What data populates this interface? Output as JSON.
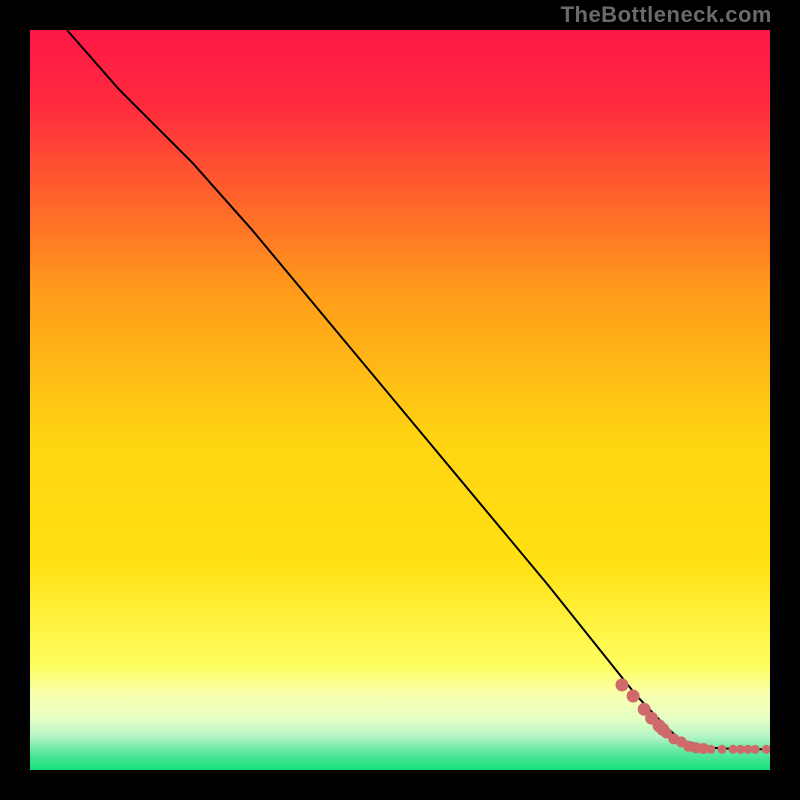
{
  "watermark": "TheBottleneck.com",
  "colors": {
    "frame": "#000000",
    "line": "#000000",
    "dot": "#cf6a6a",
    "gradient_top": "#ff1846",
    "gradient_mid": "#ffe012",
    "gradient_yellowbright": "#ffff60",
    "gradient_bottom": "#13e07a"
  },
  "chart_data": {
    "type": "line",
    "title": "",
    "xlabel": "",
    "ylabel": "",
    "xlim": [
      0,
      100
    ],
    "ylim": [
      0,
      100
    ],
    "grid": false,
    "series": [
      {
        "name": "bottleneck-curve",
        "x": [
          5,
          12,
          22,
          30,
          40,
          50,
          60,
          70,
          78,
          82,
          86,
          88,
          92,
          96,
          100
        ],
        "y": [
          100,
          92,
          82,
          73,
          61,
          49,
          37,
          25,
          15,
          10,
          5.8,
          4.0,
          3.0,
          2.8,
          2.8
        ]
      }
    ],
    "points": {
      "name": "observed-points",
      "x": [
        80,
        81.5,
        83,
        84,
        85,
        85.5,
        86,
        87,
        88,
        89,
        90,
        91,
        92,
        93.5,
        95,
        96,
        97,
        98,
        99.5
      ],
      "y": [
        11.5,
        10.0,
        8.2,
        7.0,
        6.0,
        5.5,
        5.0,
        4.2,
        3.8,
        3.2,
        3.0,
        2.9,
        2.8,
        2.8,
        2.8,
        2.8,
        2.8,
        2.8,
        2.8
      ]
    },
    "gradient_stops": [
      {
        "offset": 0.0,
        "color": "#ff1846"
      },
      {
        "offset": 0.1,
        "color": "#ff2a3e"
      },
      {
        "offset": 0.35,
        "color": "#ff9a1a"
      },
      {
        "offset": 0.55,
        "color": "#ffd412"
      },
      {
        "offset": 0.72,
        "color": "#ffe012"
      },
      {
        "offset": 0.86,
        "color": "#ffff60"
      },
      {
        "offset": 0.9,
        "color": "#f7ffb0"
      },
      {
        "offset": 0.93,
        "color": "#e6ffc5"
      },
      {
        "offset": 0.955,
        "color": "#b3f5c4"
      },
      {
        "offset": 0.975,
        "color": "#60e8a0"
      },
      {
        "offset": 1.0,
        "color": "#13e07a"
      }
    ]
  }
}
